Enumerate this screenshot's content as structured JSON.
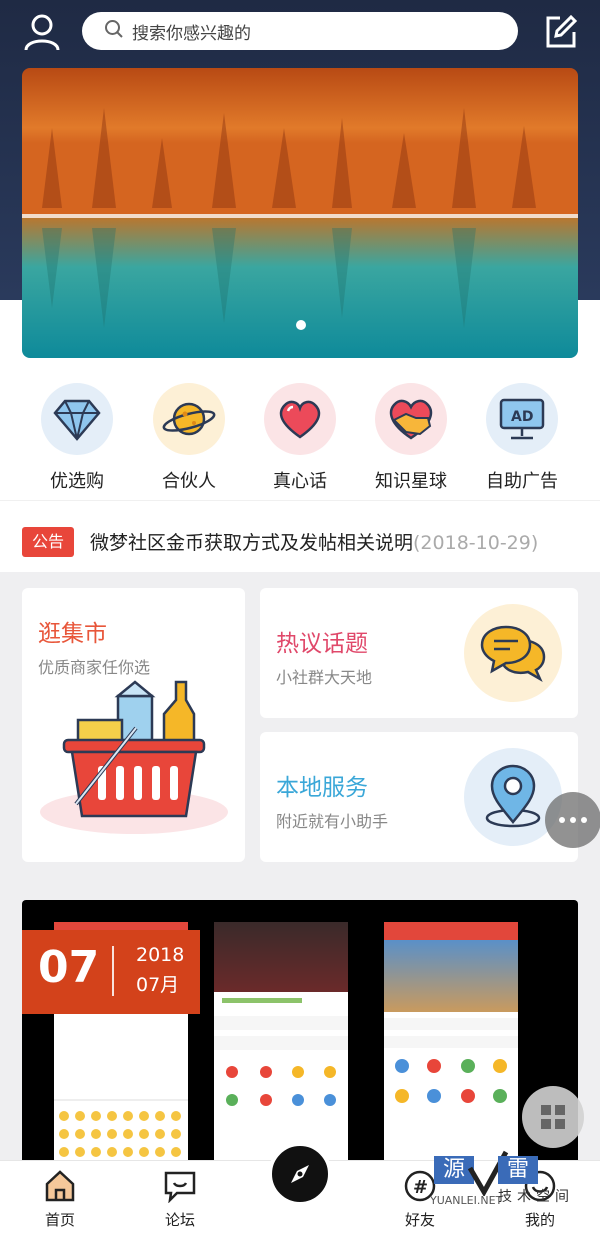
{
  "header": {
    "search_placeholder": "搜索你感兴趣的"
  },
  "icons": [
    {
      "label": "优选购",
      "icon": "diamond-icon",
      "bg": "#e4eef8"
    },
    {
      "label": "合伙人",
      "icon": "planet-icon",
      "bg": "#fdf0d6"
    },
    {
      "label": "真心话",
      "icon": "heart-icon",
      "bg": "#fbe4e6"
    },
    {
      "label": "知识星球",
      "icon": "handshake-heart-icon",
      "bg": "#fbe4e6"
    },
    {
      "label": "自助广告",
      "icon": "ad-screen-icon",
      "bg": "#e4eef8"
    }
  ],
  "notice": {
    "badge": "公告",
    "text": "微梦社区金币获取方式及发帖相关说明",
    "date": "(2018-10-29)"
  },
  "cards": {
    "market": {
      "title": "逛集市",
      "subtitle": "优质商家任你选",
      "color": "#e8563a"
    },
    "topics": {
      "title": "热议话题",
      "subtitle": "小社群大天地",
      "color": "#e0486a"
    },
    "local": {
      "title": "本地服务",
      "subtitle": "附近就有小助手",
      "color": "#3aa7d8"
    }
  },
  "date_badge": {
    "day": "07",
    "year": "2018",
    "month": "07月"
  },
  "tabbar": {
    "home": "首页",
    "forum": "论坛",
    "friends": "好友",
    "mine": "我的"
  },
  "watermark": {
    "char_a": "源",
    "char_b": "雷",
    "site": "YUANLEI.NET",
    "tech": "技术空间"
  }
}
